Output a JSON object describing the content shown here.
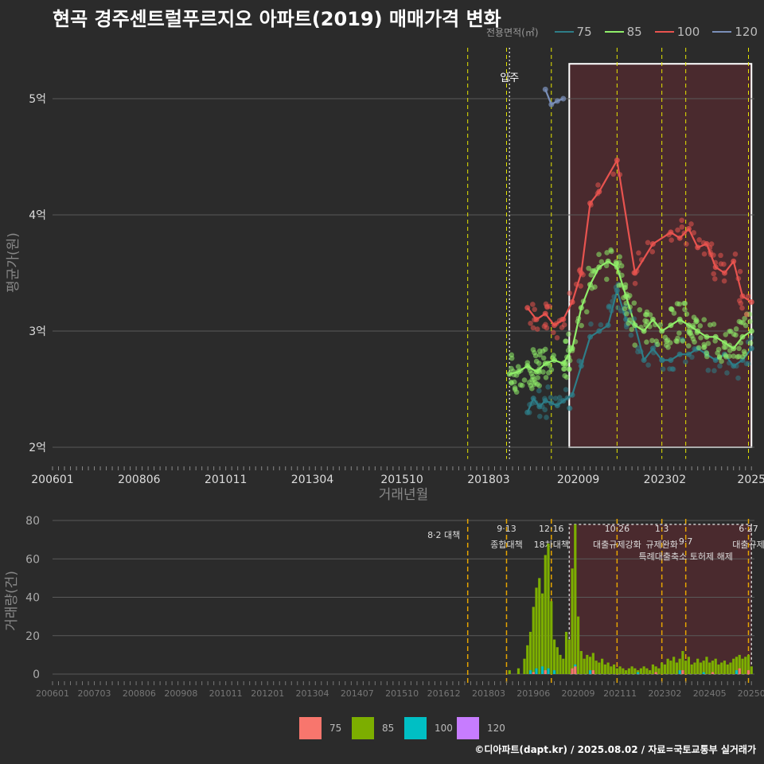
{
  "title": "현곡 경주센트럴푸르지오 아파트(2019) 매매가격 변화",
  "legend_top": {
    "title": "전용면적(㎡)",
    "items": [
      {
        "label": "75",
        "color": "#2e7d88"
      },
      {
        "label": "85",
        "color": "#90ee6a"
      },
      {
        "label": "100",
        "color": "#e8534f"
      },
      {
        "label": "120",
        "color": "#7a8fb8"
      }
    ]
  },
  "legend_bottom": {
    "items": [
      {
        "label": "75",
        "color": "#f8766d"
      },
      {
        "label": "85",
        "color": "#7cae00"
      },
      {
        "label": "100",
        "color": "#00bfc4"
      },
      {
        "label": "120",
        "color": "#c77cff"
      }
    ]
  },
  "footer": "©디아파트(dapt.kr) / 2025.08.02 / 자료=국토교통부 실거래가",
  "chart_data": [
    {
      "type": "line",
      "xlabel": "거래년월",
      "ylabel": "평균가(원)",
      "x_ticks": [
        "200601",
        "200806",
        "201011",
        "201304",
        "201510",
        "201803",
        "202009",
        "202302",
        "2025"
      ],
      "y_ticks": [
        "2억",
        "3억",
        "4억",
        "5억"
      ],
      "y_tick_values": [
        2,
        3,
        4,
        5
      ],
      "ylim": [
        1.9,
        5.3
      ],
      "x_range": [
        "2006-01",
        "2025-08"
      ],
      "annotation": "입주",
      "annotation_date": "2018-10",
      "highlight_range": [
        "2020-06",
        "2025-07"
      ],
      "series": [
        {
          "name": "75",
          "color": "#2e7d88",
          "points": [
            [
              "2019-04",
              2.3
            ],
            [
              "2019-06",
              2.42
            ],
            [
              "2019-08",
              2.35
            ],
            [
              "2019-10",
              2.4
            ],
            [
              "2019-12",
              2.38
            ],
            [
              "2020-02",
              2.36
            ],
            [
              "2020-04",
              2.4
            ],
            [
              "2020-07",
              2.45
            ],
            [
              "2020-10",
              2.7
            ],
            [
              "2021-01",
              2.95
            ],
            [
              "2021-04",
              3.0
            ],
            [
              "2021-07",
              3.05
            ],
            [
              "2021-10",
              3.35
            ],
            [
              "2022-01",
              3.1
            ],
            [
              "2022-04",
              3.05
            ],
            [
              "2022-07",
              2.75
            ],
            [
              "2022-10",
              2.85
            ],
            [
              "2023-01",
              2.75
            ],
            [
              "2023-04",
              2.75
            ],
            [
              "2023-07",
              2.8
            ],
            [
              "2023-10",
              2.8
            ],
            [
              "2024-01",
              2.85
            ],
            [
              "2024-04",
              2.8
            ],
            [
              "2024-07",
              2.75
            ],
            [
              "2024-10",
              2.8
            ],
            [
              "2025-01",
              2.7
            ],
            [
              "2025-04",
              2.75
            ],
            [
              "2025-07",
              2.85
            ]
          ]
        },
        {
          "name": "85",
          "color": "#90ee6a",
          "points": [
            [
              "2018-10",
              2.63
            ],
            [
              "2019-01",
              2.65
            ],
            [
              "2019-04",
              2.7
            ],
            [
              "2019-07",
              2.65
            ],
            [
              "2019-10",
              2.72
            ],
            [
              "2020-01",
              2.75
            ],
            [
              "2020-04",
              2.72
            ],
            [
              "2020-07",
              2.85
            ],
            [
              "2020-10",
              3.2
            ],
            [
              "2021-01",
              3.4
            ],
            [
              "2021-04",
              3.55
            ],
            [
              "2021-07",
              3.6
            ],
            [
              "2021-10",
              3.55
            ],
            [
              "2022-01",
              3.3
            ],
            [
              "2022-04",
              3.05
            ],
            [
              "2022-07",
              3.0
            ],
            [
              "2022-10",
              3.1
            ],
            [
              "2023-01",
              3.0
            ],
            [
              "2023-04",
              3.05
            ],
            [
              "2023-07",
              3.1
            ],
            [
              "2023-10",
              3.05
            ],
            [
              "2024-01",
              3.0
            ],
            [
              "2024-04",
              2.95
            ],
            [
              "2024-07",
              2.95
            ],
            [
              "2024-10",
              2.9
            ],
            [
              "2025-01",
              2.85
            ],
            [
              "2025-04",
              2.95
            ],
            [
              "2025-07",
              3.0
            ]
          ]
        },
        {
          "name": "100",
          "color": "#e8534f",
          "points": [
            [
              "2019-04",
              3.2
            ],
            [
              "2019-07",
              3.1
            ],
            [
              "2019-10",
              3.15
            ],
            [
              "2020-01",
              3.05
            ],
            [
              "2020-04",
              3.1
            ],
            [
              "2020-07",
              3.25
            ],
            [
              "2020-10",
              3.5
            ],
            [
              "2021-01",
              4.1
            ],
            [
              "2021-04",
              4.2
            ],
            [
              "2021-10",
              4.47
            ],
            [
              "2022-04",
              3.5
            ],
            [
              "2022-10",
              3.75
            ],
            [
              "2023-04",
              3.85
            ],
            [
              "2023-07",
              3.8
            ],
            [
              "2023-10",
              3.88
            ],
            [
              "2024-01",
              3.72
            ],
            [
              "2024-04",
              3.75
            ],
            [
              "2024-07",
              3.55
            ],
            [
              "2024-10",
              3.5
            ],
            [
              "2025-01",
              3.6
            ],
            [
              "2025-04",
              3.3
            ],
            [
              "2025-07",
              3.25
            ]
          ]
        },
        {
          "name": "120",
          "color": "#7a8fb8",
          "points": [
            [
              "2019-10",
              5.08
            ],
            [
              "2019-12",
              4.95
            ],
            [
              "2020-02",
              4.98
            ],
            [
              "2020-04",
              5.0
            ]
          ]
        }
      ]
    },
    {
      "type": "bar",
      "ylabel": "거래량(건)",
      "x_ticks": [
        "200601",
        "200703",
        "200806",
        "200908",
        "201011",
        "201201",
        "201304",
        "201407",
        "201510",
        "201612",
        "201803",
        "201906",
        "202009",
        "202111",
        "202302",
        "202405",
        "20250"
      ],
      "y_ticks": [
        "0",
        "20",
        "40",
        "60",
        "80"
      ],
      "y_tick_values": [
        0,
        20,
        40,
        60,
        80
      ],
      "ylim": [
        -2,
        82
      ],
      "events": [
        {
          "date": "2017-08",
          "label": "8·2 대책"
        },
        {
          "date": "2018-09",
          "label": "9·13\n종합대책"
        },
        {
          "date": "2019-12",
          "label": "12·16\n18차대책"
        },
        {
          "date": "2021-10",
          "label": "10·26\n대출규제강화"
        },
        {
          "date": "2023-01",
          "label": "1·3\n규제완화"
        },
        {
          "date": "2023-09",
          "label": "9·7\n특례대출축소 토허제 해제"
        },
        {
          "date": "2025-06",
          "label": "6·27\n대출규제"
        }
      ],
      "series": [
        {
          "name": "75",
          "values_note": "minor",
          "color": "#f8766d"
        },
        {
          "name": "85",
          "color": "#7cae00"
        },
        {
          "name": "100",
          "color": "#00bfc4"
        },
        {
          "name": "120",
          "color": "#c77cff"
        }
      ],
      "volume_85": [
        [
          "2018-10",
          2
        ],
        [
          "2019-01",
          3
        ],
        [
          "2019-03",
          8
        ],
        [
          "2019-04",
          15
        ],
        [
          "2019-05",
          22
        ],
        [
          "2019-06",
          35
        ],
        [
          "2019-07",
          45
        ],
        [
          "2019-08",
          50
        ],
        [
          "2019-09",
          42
        ],
        [
          "2019-10",
          62
        ],
        [
          "2019-11",
          68
        ],
        [
          "2019-12",
          38
        ],
        [
          "2020-01",
          18
        ],
        [
          "2020-02",
          14
        ],
        [
          "2020-03",
          10
        ],
        [
          "2020-04",
          8
        ],
        [
          "2020-05",
          22
        ],
        [
          "2020-06",
          18
        ],
        [
          "2020-07",
          55
        ],
        [
          "2020-08",
          78
        ],
        [
          "2020-09",
          30
        ],
        [
          "2020-10",
          12
        ],
        [
          "2020-11",
          8
        ],
        [
          "2020-12",
          10
        ],
        [
          "2021-01",
          9
        ],
        [
          "2021-02",
          11
        ],
        [
          "2021-03",
          7
        ],
        [
          "2021-04",
          6
        ],
        [
          "2021-05",
          8
        ],
        [
          "2021-06",
          5
        ],
        [
          "2021-07",
          6
        ],
        [
          "2021-08",
          4
        ],
        [
          "2021-09",
          5
        ],
        [
          "2021-10",
          3
        ],
        [
          "2021-11",
          4
        ],
        [
          "2021-12",
          3
        ],
        [
          "2022-01",
          2
        ],
        [
          "2022-02",
          3
        ],
        [
          "2022-03",
          4
        ],
        [
          "2022-04",
          3
        ],
        [
          "2022-05",
          2
        ],
        [
          "2022-06",
          3
        ],
        [
          "2022-07",
          4
        ],
        [
          "2022-08",
          3
        ],
        [
          "2022-09",
          2
        ],
        [
          "2022-10",
          5
        ],
        [
          "2022-11",
          4
        ],
        [
          "2022-12",
          3
        ],
        [
          "2023-01",
          6
        ],
        [
          "2023-02",
          5
        ],
        [
          "2023-03",
          8
        ],
        [
          "2023-04",
          7
        ],
        [
          "2023-05",
          9
        ],
        [
          "2023-06",
          6
        ],
        [
          "2023-07",
          8
        ],
        [
          "2023-08",
          12
        ],
        [
          "2023-09",
          7
        ],
        [
          "2023-10",
          9
        ],
        [
          "2023-11",
          5
        ],
        [
          "2023-12",
          6
        ],
        [
          "2024-01",
          8
        ],
        [
          "2024-02",
          6
        ],
        [
          "2024-03",
          7
        ],
        [
          "2024-04",
          9
        ],
        [
          "2024-05",
          6
        ],
        [
          "2024-06",
          7
        ],
        [
          "2024-07",
          8
        ],
        [
          "2024-08",
          5
        ],
        [
          "2024-09",
          6
        ],
        [
          "2024-10",
          7
        ],
        [
          "2024-11",
          5
        ],
        [
          "2024-12",
          6
        ],
        [
          "2025-01",
          8
        ],
        [
          "2025-02",
          9
        ],
        [
          "2025-03",
          10
        ],
        [
          "2025-04",
          8
        ],
        [
          "2025-05",
          9
        ],
        [
          "2025-06",
          10
        ],
        [
          "2025-07",
          4
        ]
      ],
      "volume_100": [
        [
          "2019-05",
          2
        ],
        [
          "2019-07",
          3
        ],
        [
          "2019-09",
          4
        ],
        [
          "2019-11",
          3
        ],
        [
          "2020-01",
          2
        ],
        [
          "2020-08",
          5
        ],
        [
          "2021-01",
          2
        ],
        [
          "2022-05",
          1
        ],
        [
          "2023-07",
          2
        ],
        [
          "2024-03",
          1
        ],
        [
          "2025-02",
          2
        ]
      ],
      "volume_75": [
        [
          "2019-06",
          1
        ],
        [
          "2019-10",
          2
        ],
        [
          "2020-07",
          3
        ],
        [
          "2020-08",
          4
        ],
        [
          "2021-02",
          2
        ],
        [
          "2022-11",
          1
        ],
        [
          "2023-08",
          2
        ],
        [
          "2024-06",
          1
        ],
        [
          "2025-03",
          3
        ],
        [
          "2025-06",
          2
        ]
      ]
    }
  ]
}
